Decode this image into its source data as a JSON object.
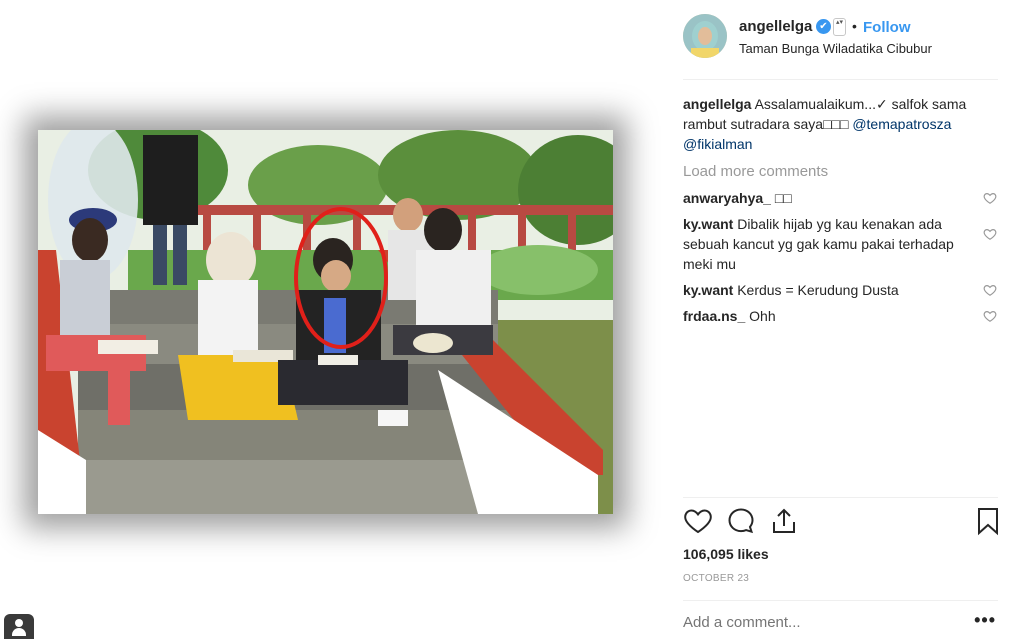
{
  "post": {
    "username": "angellelga",
    "verified_mark": "✔",
    "scroll_arrows": "▴▾",
    "separator": "•",
    "follow_label": "Follow",
    "location": "Taman Bunga Wiladatika Cibubur"
  },
  "caption": {
    "user": "angellelga",
    "text": "Assalamualaikum...✓ salfok sama rambut sutradara saya□□□",
    "mention1": "@temapatrosza",
    "mention2": "@fikialman"
  },
  "load_more_label": "Load more comments",
  "comments": [
    {
      "user": "anwaryahya_",
      "text": "□□"
    },
    {
      "user": "ky.want",
      "text": "Dibalik hijab yg kau kenakan ada sebuah kancut yg gak kamu pakai terhadap meki mu"
    },
    {
      "user": "ky.want",
      "text": "Kerdus = Kerudung Dusta"
    },
    {
      "user": "frdaa.ns_",
      "text": "Ohh"
    }
  ],
  "likes_text": "106,095 likes",
  "date_text": "OCTOBER 23",
  "add_comment_placeholder": "Add a comment...",
  "more_options": "•••",
  "icons": {
    "like": "heart-icon",
    "comment": "comment-icon",
    "share": "share-icon",
    "save": "bookmark-icon",
    "camera": "camera-icon"
  },
  "colors": {
    "link_blue": "#3897f0",
    "mention_blue": "#003569",
    "muted_gray": "#999999",
    "highlight_circle": "#e0201a"
  }
}
